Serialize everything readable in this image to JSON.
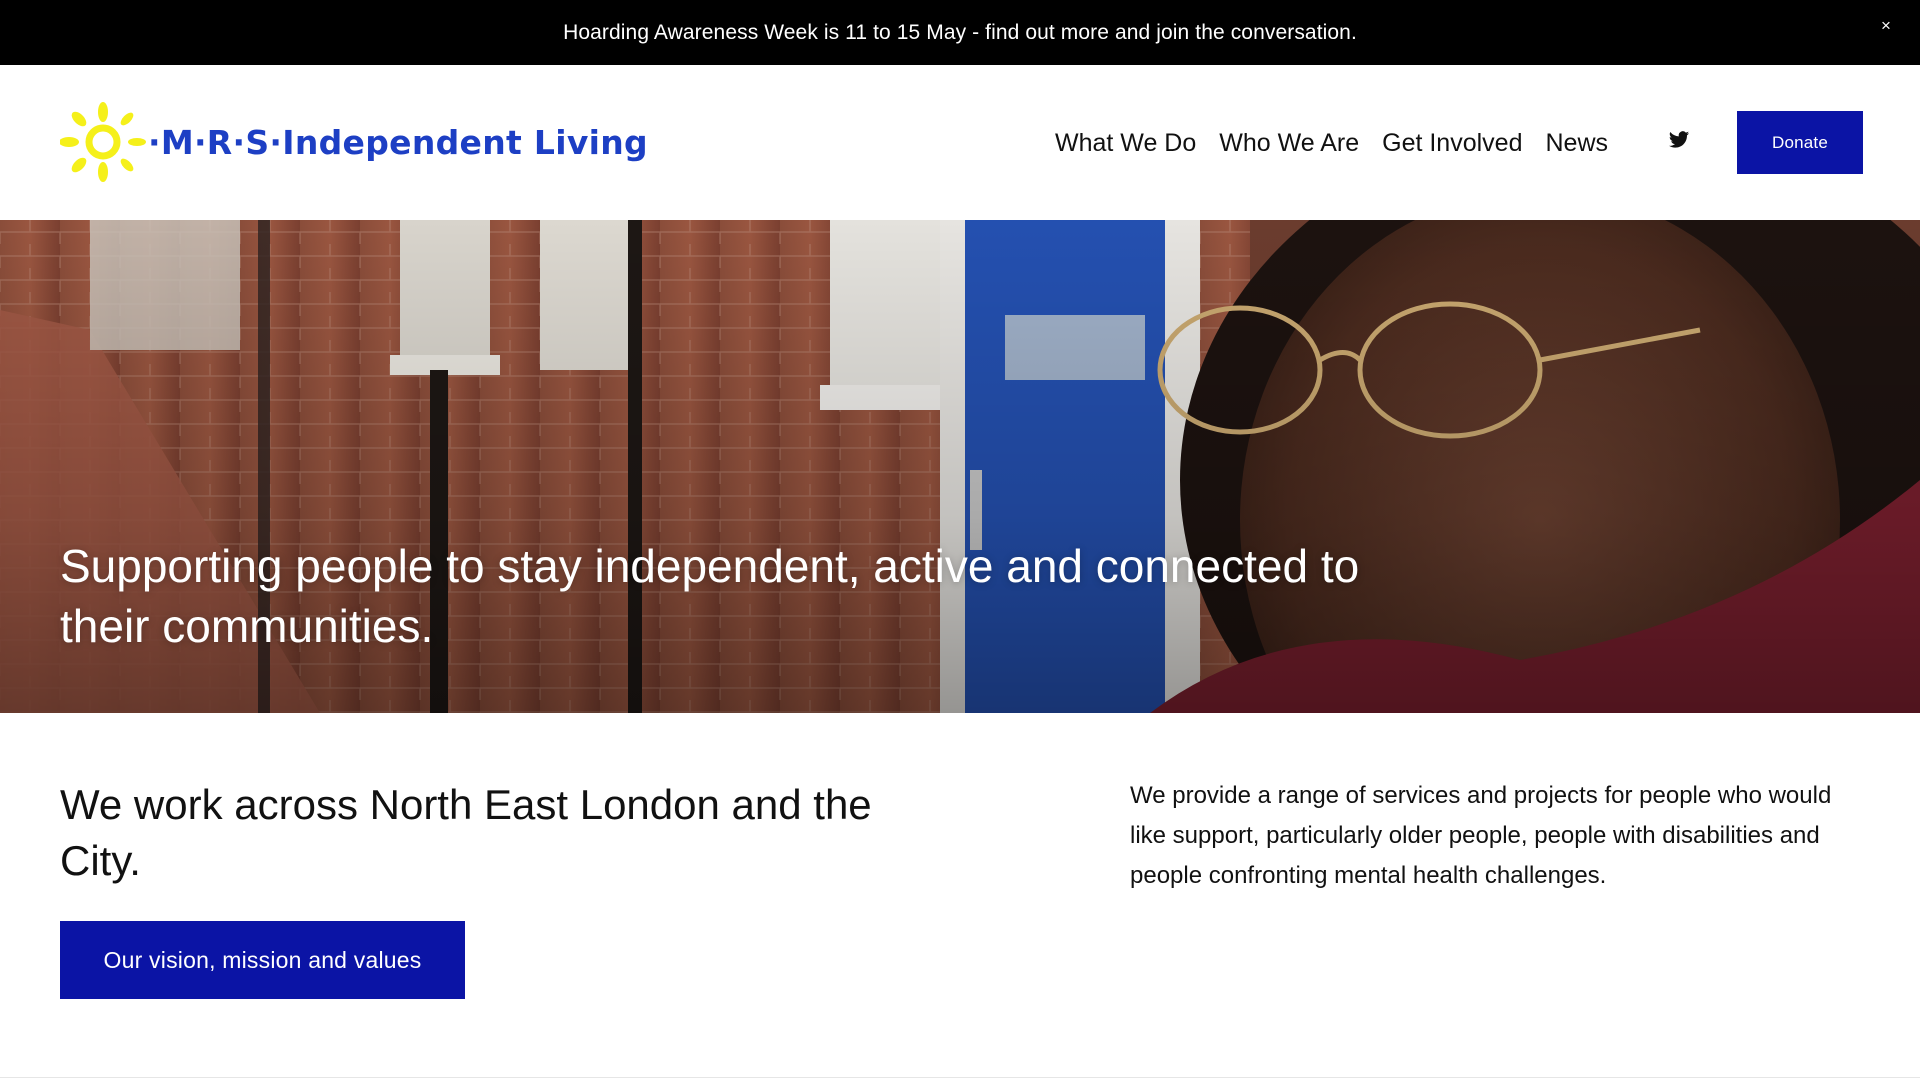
{
  "announcement": {
    "text": "Hoarding Awareness Week is 11 to 15 May - find out more and join the conversation.",
    "close_glyph": "×"
  },
  "header": {
    "logo_text": "·M·R·S·Independent Living",
    "nav": [
      "What We Do",
      "Who We Are",
      "Get Involved",
      "News"
    ],
    "social_icon": "twitter-icon",
    "donate_label": "Donate"
  },
  "hero": {
    "heading": "Supporting people to stay independent, active and connected to their communities."
  },
  "intro": {
    "heading": "We work across North East London and the City.",
    "button_label": "Our vision, mission and values",
    "body": "We provide a range of services and projects for people who would like support, particularly older people, people with disabilities and people confronting mental health challenges."
  },
  "colors": {
    "announcement_bg": "#000000",
    "brand_blue": "#1d3fc4",
    "button_blue": "#0b14a5",
    "sun_yellow": "#f5f01a"
  }
}
